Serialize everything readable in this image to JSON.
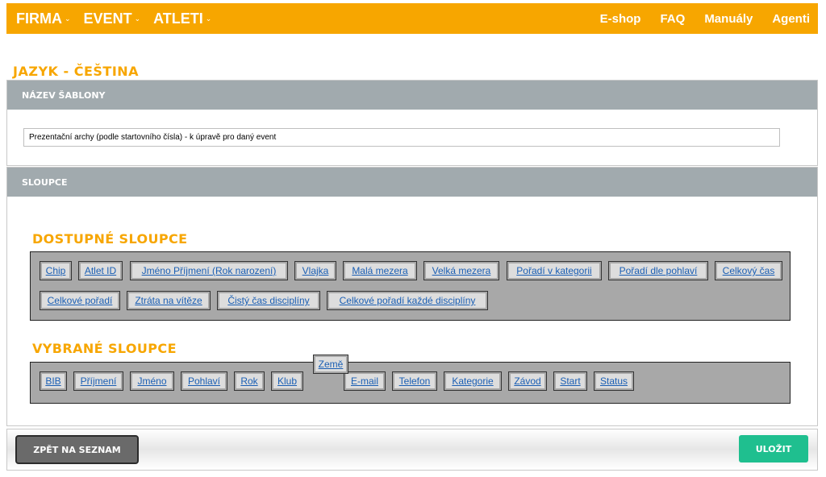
{
  "topnav": {
    "left": [
      {
        "label": "FIRMA"
      },
      {
        "label": "EVENT"
      },
      {
        "label": "ATLETI"
      }
    ],
    "right": [
      {
        "label": "E-shop"
      },
      {
        "label": "FAQ"
      },
      {
        "label": "Manuály"
      },
      {
        "label": "Agenti"
      }
    ],
    "dropdown_icon": "chevron-down-icon"
  },
  "language_title": "JAZYK - ČEŠTINA",
  "template_panel": {
    "header": "NÁZEV ŠABLONY",
    "value": "Prezentační archy (podle startovního čísla) - k úpravě pro daný event"
  },
  "columns_panel": {
    "header": "SLOUPCE",
    "available_title": "DOSTUPNÉ SLOUPCE",
    "available": [
      "Chip",
      "Atlet ID",
      "Jméno Příjmení (Rok narození)",
      "Vlajka",
      "Malá mezera",
      "Velká mezera",
      "Pořadí v kategorii",
      "Pořadí dle pohlaví",
      "Celkový čas",
      "Celkové pořadí",
      "Ztráta na vítěze",
      "Čistý čas disciplíny",
      "Celkové pořadí každé disciplíny"
    ],
    "selected_title": "VYBRANÉ SLOUPCE",
    "selected": [
      "BIB",
      "Příjmení",
      "Jméno",
      "Pohlaví",
      "Rok",
      "Klub",
      "E-mail",
      "Telefon",
      "Kategorie",
      "Závod",
      "Start",
      "Status"
    ],
    "dragging": "Země"
  },
  "footer": {
    "back_label": "ZPĚT NA SEZNAM",
    "save_label": "ULOŽIT"
  },
  "colors": {
    "accent": "#f7a600",
    "panel_header": "#a1aaae",
    "save": "#1fbf8f",
    "link": "#1b5fb4"
  }
}
